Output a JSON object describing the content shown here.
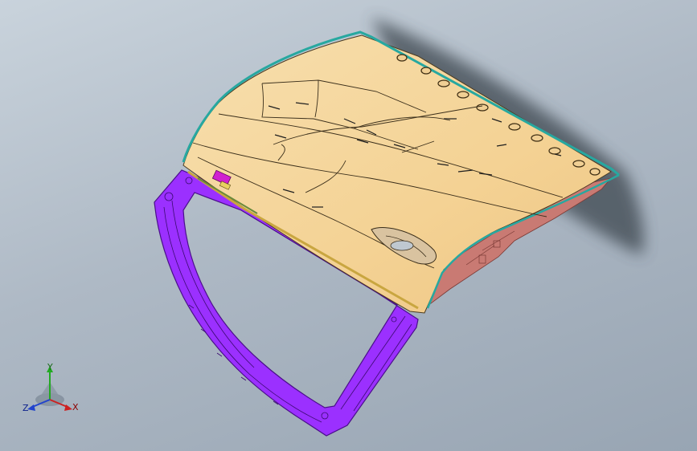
{
  "viewport": {
    "background_top": "#c9d3dc",
    "background_bottom": "#98a5b3"
  },
  "model": {
    "panel_color": "#f5d79b",
    "frame_color": "#9b30ff",
    "inner_color": "#c97a73",
    "edge_color": "#27a8a0",
    "shadow_color": "#3e4750"
  },
  "triad": {
    "x_label": "X",
    "y_label": "Y",
    "z_label": "Z",
    "x_color": "#cc2222",
    "y_color": "#22aa22",
    "z_color": "#2244cc"
  }
}
